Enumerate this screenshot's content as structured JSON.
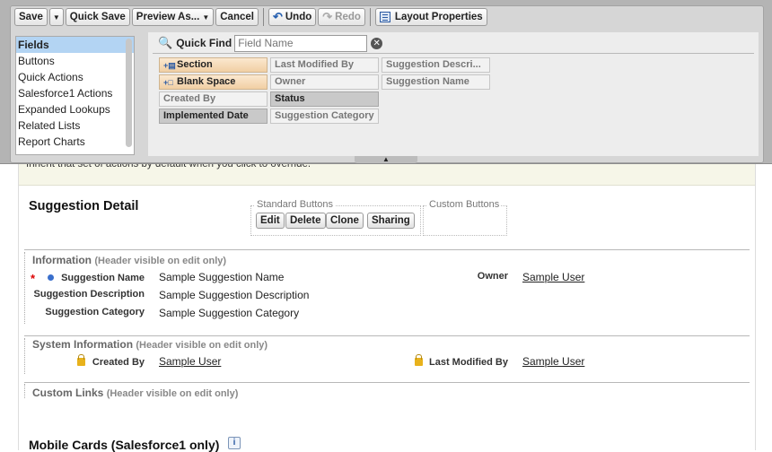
{
  "toolbar": {
    "save": "Save",
    "quick_save": "Quick Save",
    "preview_as": "Preview As...",
    "cancel": "Cancel",
    "undo": "Undo",
    "redo": "Redo",
    "layout_properties": "Layout Properties"
  },
  "palette": {
    "categories": [
      "Fields",
      "Buttons",
      "Quick Actions",
      "Salesforce1 Actions",
      "Expanded Lookups",
      "Related Lists",
      "Report Charts"
    ],
    "selected_category": "Fields",
    "quick_find_label": "Quick Find",
    "quick_find_placeholder": "Field Name",
    "items": {
      "section": "Section",
      "blank_space": "Blank Space",
      "created_by": "Created By",
      "implemented_date": "Implemented Date",
      "last_modified_by": "Last Modified By",
      "owner": "Owner",
      "status": "Status",
      "suggestion_category": "Suggestion Category",
      "suggestion_description": "Suggestion Descri...",
      "suggestion_name": "Suggestion Name"
    }
  },
  "layout": {
    "info_text": "Inherit that set of actions by default when you click to override.",
    "detail_title": "Suggestion Detail",
    "standard_buttons_label": "Standard Buttons",
    "custom_buttons_label": "Custom Buttons",
    "standard_buttons": [
      "Edit",
      "Delete",
      "Clone",
      "Sharing"
    ],
    "information": {
      "title": "Information",
      "note": "(Header visible on edit only)",
      "fields": [
        {
          "label": "Suggestion Name",
          "value": "Sample Suggestion Name"
        },
        {
          "label": "Suggestion Description",
          "value": "Sample Suggestion Description"
        },
        {
          "label": "Suggestion Category",
          "value": "Sample Suggestion Category"
        },
        {
          "label": "Owner",
          "value": "Sample User"
        }
      ]
    },
    "system_information": {
      "title": "System Information",
      "note": "(Header visible on edit only)",
      "fields": [
        {
          "label": "Created By",
          "value": "Sample User"
        },
        {
          "label": "Last Modified By",
          "value": "Sample User"
        }
      ]
    },
    "custom_links": {
      "title": "Custom Links",
      "note": "(Header visible on edit only)"
    },
    "mobile_cards_title": "Mobile Cards (Salesforce1 only)"
  }
}
